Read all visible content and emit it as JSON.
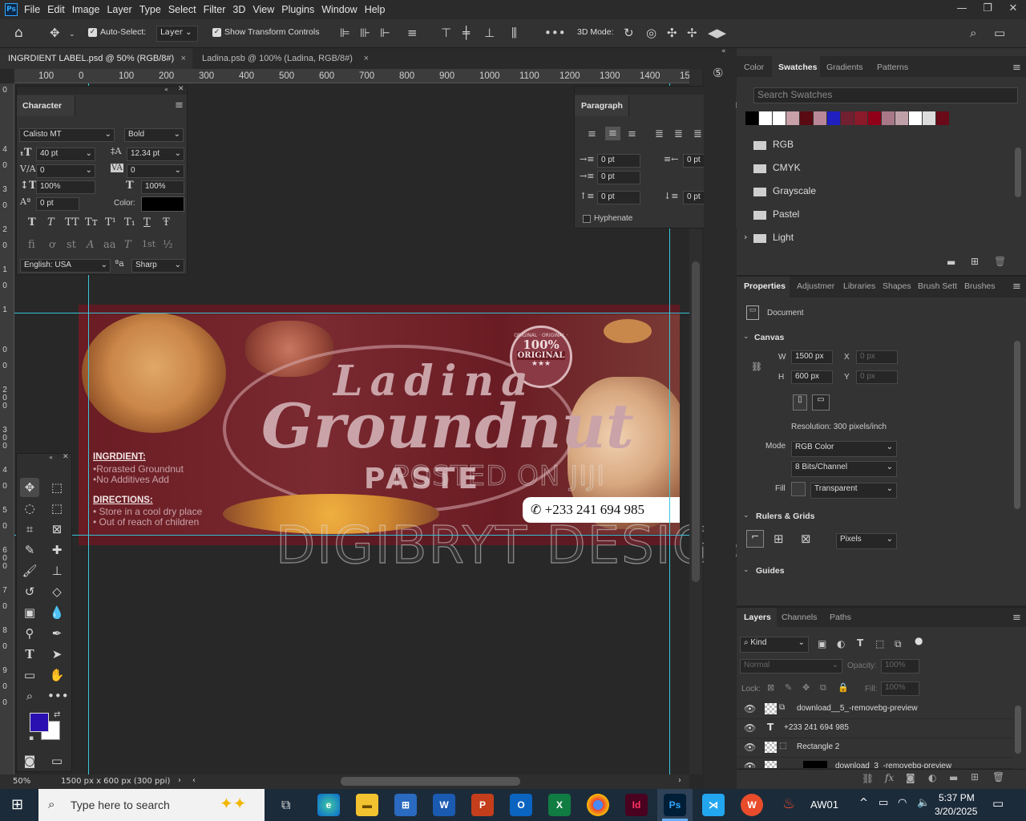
{
  "app": {
    "logo": "Ps",
    "menu": [
      "File",
      "Edit",
      "Image",
      "Layer",
      "Type",
      "Select",
      "Filter",
      "3D",
      "View",
      "Plugins",
      "Window",
      "Help"
    ],
    "window_controls": [
      "—",
      "❐",
      "✕"
    ]
  },
  "options": {
    "auto_select_label": "Auto-Select:",
    "auto_select_target": "Layer",
    "show_transform_label": "Show Transform Controls",
    "three_d_mode": "3D Mode:"
  },
  "tabs": [
    {
      "label": "INGRDIENT LABEL.psd @ 50% (RGB/8#)",
      "close": "×"
    },
    {
      "label": "Ladina.psb @ 100% (Ladina, RGB/8#)",
      "close": "×"
    }
  ],
  "ruler_top": [
    "100",
    "0",
    "100",
    "200",
    "300",
    "400",
    "500",
    "600",
    "700",
    "800",
    "900",
    "1000",
    "1100",
    "1200",
    "1300",
    "1400",
    "15"
  ],
  "ruler_left": [
    "0",
    "4",
    "0",
    "3",
    "0",
    "2",
    "0",
    "1",
    "0",
    "1",
    "0",
    "0",
    "2",
    "0",
    "0",
    "3",
    "0",
    "0",
    "4",
    "0",
    "5",
    "0",
    "6",
    "0",
    "0",
    "7",
    "0",
    "8",
    "0",
    "9",
    "0",
    "0"
  ],
  "character": {
    "title": "Character",
    "font_family": "Calisto MT",
    "font_style": "Bold",
    "size": "40 pt",
    "leading": "12.34 pt",
    "kerning": "0",
    "tracking": "0",
    "vscale": "100%",
    "hscale": "100%",
    "baseline": "0 pt",
    "color_label": "Color:",
    "language": "English: USA",
    "aa_icon": "ªa",
    "antialias": "Sharp",
    "style_glyphs": [
      "T",
      "T",
      "TT",
      "Tт",
      "T¹",
      "T₁",
      "T",
      "Ŧ"
    ],
    "ot_glyphs": [
      "fi",
      "ơ",
      "st",
      "A",
      "aa",
      "T",
      "1st",
      "½"
    ]
  },
  "paragraph": {
    "title": "Paragraph",
    "indent_left": "0 pt",
    "indent_right": "0 pt",
    "first_line": "0 pt",
    "space_before": "0 pt",
    "space_after": "0 pt",
    "hyphenate": "Hyphenate"
  },
  "artwork": {
    "title_1": "Ladina",
    "title_2": "Groundnut",
    "title_3": "PASTE",
    "badge_top": "ORIGINAL · ORIGINAL ·",
    "badge_pct": "100%",
    "badge_word": "ORIGINAL",
    "ingredients_heading": "INGRDIENT:",
    "ingredients": [
      "•Rorasted Groundnut",
      "•No Additives Add"
    ],
    "directions_heading": "DIRECTIONS:",
    "directions": [
      "• Store in a cool dry place",
      "• Out of reach of children"
    ],
    "phone": "+233 241 694 985",
    "watermark_1": "POSTED ON JIJI",
    "watermark_2": "DIGIBRYT DESIGN"
  },
  "status": {
    "zoom": "50%",
    "doc_info": "1500 px x 600 px (300 ppi)"
  },
  "swatches_panel": {
    "tabs": [
      "Color",
      "Swatches",
      "Gradients",
      "Patterns"
    ],
    "search_placeholder": "Search Swatches",
    "colors": [
      "#000000",
      "#ffffff",
      "#ffffff",
      "#c8a0a8",
      "#5a0a12",
      "#b88898",
      "#2020c0",
      "#702030",
      "#8a1a2a",
      "#900018",
      "#a87888",
      "#c0a0a8",
      "#ffffff",
      "#dcdcdc",
      "#6a0a18"
    ],
    "groups": [
      "RGB",
      "CMYK",
      "Grayscale",
      "Pastel",
      "Light"
    ]
  },
  "properties_panel": {
    "tabs": [
      "Properties",
      "Adjustmer",
      "Libraries",
      "Shapes",
      "Brush Sett",
      "Brushes"
    ],
    "doc_label": "Document",
    "canvas_heading": "Canvas",
    "w_label": "W",
    "w": "1500 px",
    "h_label": "H",
    "h": "600 px",
    "x_label": "X",
    "x": "0 px",
    "y_label": "Y",
    "y": "0 px",
    "resolution": "Resolution: 300 pixels/inch",
    "mode_label": "Mode",
    "mode": "RGB Color",
    "bits": "8 Bits/Channel",
    "fill_label": "Fill",
    "fill": "Transparent",
    "rulers_heading": "Rulers & Grids",
    "units": "Pixels",
    "guides_heading": "Guides"
  },
  "layers_panel": {
    "tabs": [
      "Layers",
      "Channels",
      "Paths"
    ],
    "kind": "Kind",
    "blend": "Normal",
    "opacity_label": "Opacity:",
    "opacity": "100%",
    "lock_label": "Lock:",
    "fill_label": "Fill:",
    "fill": "100%",
    "layers": [
      "download__5_-removebg-preview",
      "+233 241 694 985",
      "Rectangle 2",
      "download_3_-removebg-preview"
    ]
  },
  "taskbar": {
    "search_placeholder": "Type here to search",
    "user": "AW01",
    "time": "5:37 PM",
    "date": "3/20/2025"
  }
}
